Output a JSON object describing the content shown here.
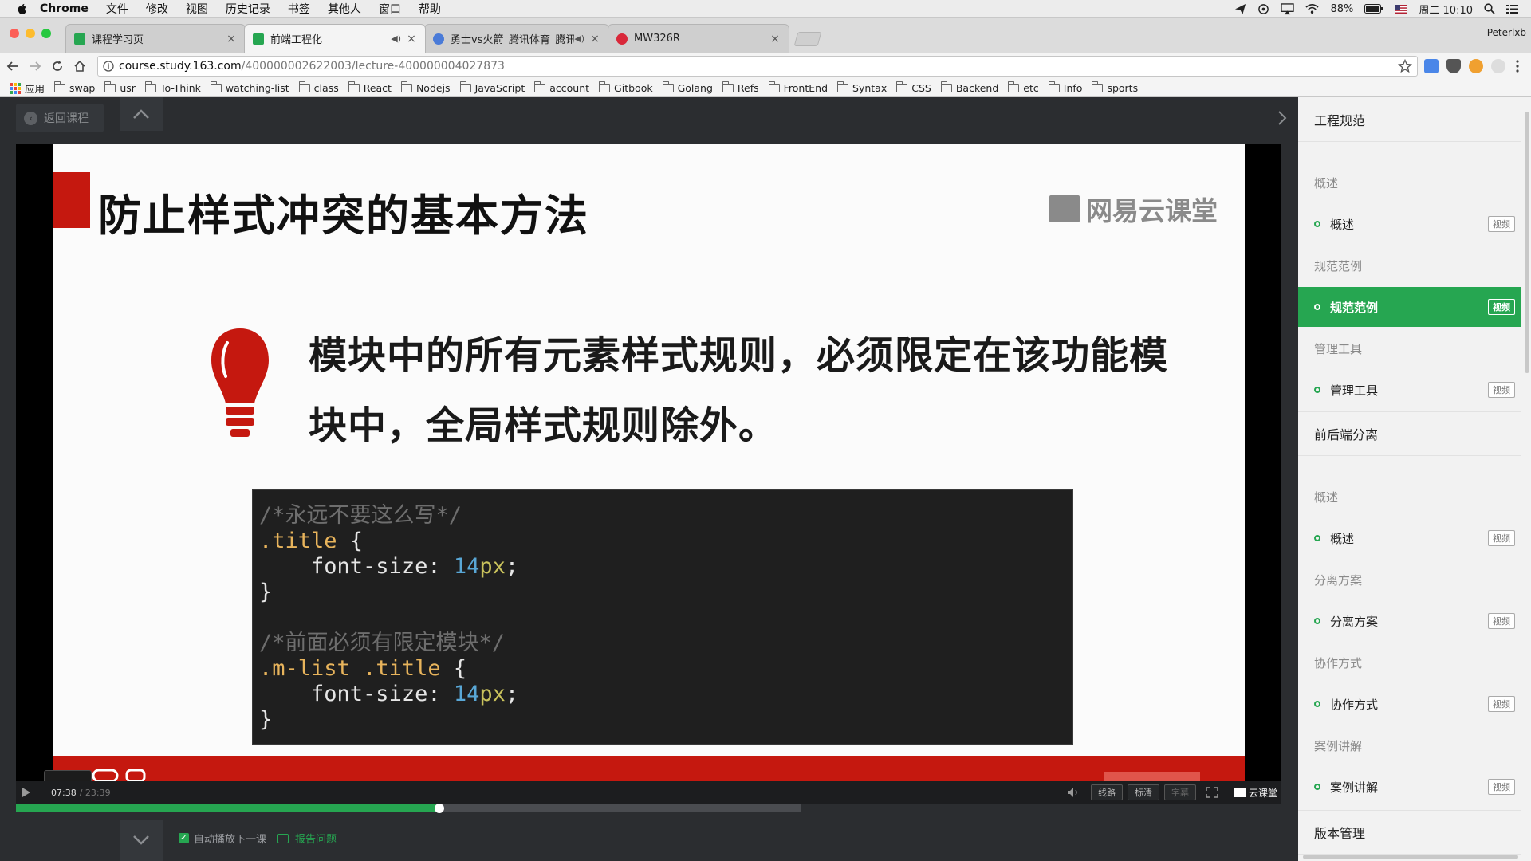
{
  "menubar": {
    "app": "Chrome",
    "items": [
      "文件",
      "修改",
      "视图",
      "历史记录",
      "书签",
      "其他人",
      "窗口",
      "帮助"
    ],
    "battery": "88%",
    "clock": "周二 10:10"
  },
  "tabs": [
    {
      "title": "课程学习页",
      "favicon_color": "#26a651",
      "audio": false,
      "active": false
    },
    {
      "title": "前端工程化",
      "favicon_color": "#26a651",
      "audio": true,
      "active": true
    },
    {
      "title": "勇士vs火箭_腾讯体育_腾讯网",
      "favicon_color": "#4a7bd8",
      "audio": true,
      "active": false
    },
    {
      "title": "MW326R",
      "favicon_color": "#d9283a",
      "audio": false,
      "active": false
    }
  ],
  "profile": "Peterlxb",
  "address": {
    "host": "course.study.163.com",
    "path": "/400000002622003/lecture-400000004027873"
  },
  "bookmarks": {
    "apps_label": "应用",
    "folders": [
      "swap",
      "usr",
      "To-Think",
      "watching-list",
      "class",
      "React",
      "Nodejs",
      "JavaScript",
      "account",
      "Gitbook",
      "Golang",
      "Refs",
      "FrontEnd",
      "Syntax",
      "CSS",
      "Backend",
      "etc",
      "Info",
      "sports"
    ]
  },
  "player": {
    "back_label": "返回课程",
    "current_time": "07:38",
    "duration": "/ 23:39",
    "progress_fraction": 0.54,
    "buttons": {
      "route": "线路",
      "quality": "标清",
      "subtitle": "字幕"
    },
    "brand_label": "云课堂",
    "autoplay_label": "自动播放下一课",
    "report_label": "报告问题"
  },
  "slide": {
    "heading": "防止样式冲突的基本方法",
    "brand": "网易云课堂",
    "point": "模块中的所有元素样式规则，必须限定在该功能模块中，全局样式规则除外。",
    "code": {
      "comment1": "/*永远不要这么写*/",
      "selector1": ".title",
      "comment2": "/*前面必须有限定模块*/",
      "selector2a": ".m-list",
      "selector2b": ".title",
      "prop": "font-size",
      "num": "14",
      "unit": "px",
      "open": " {",
      "close": "}"
    }
  },
  "sidebar": {
    "tag_label": "视频",
    "items": [
      {
        "kind": "chapter",
        "label": "工程规范"
      },
      {
        "kind": "section",
        "label": "概述"
      },
      {
        "kind": "lesson",
        "label": "概述",
        "active": false
      },
      {
        "kind": "section",
        "label": "规范范例"
      },
      {
        "kind": "lesson",
        "label": "规范范例",
        "active": true
      },
      {
        "kind": "section",
        "label": "管理工具"
      },
      {
        "kind": "lesson",
        "label": "管理工具",
        "active": false
      },
      {
        "kind": "chapter",
        "label": "前后端分离"
      },
      {
        "kind": "section",
        "label": "概述"
      },
      {
        "kind": "lesson",
        "label": "概述",
        "active": false
      },
      {
        "kind": "section",
        "label": "分离方案"
      },
      {
        "kind": "lesson",
        "label": "分离方案",
        "active": false
      },
      {
        "kind": "section",
        "label": "协作方式"
      },
      {
        "kind": "lesson",
        "label": "协作方式",
        "active": false
      },
      {
        "kind": "section",
        "label": "案例讲解"
      },
      {
        "kind": "lesson",
        "label": "案例讲解",
        "active": false
      },
      {
        "kind": "chapter",
        "label": "版本管理"
      }
    ]
  },
  "colors": {
    "accent": "#26a651",
    "slide_red": "#c5180f"
  }
}
